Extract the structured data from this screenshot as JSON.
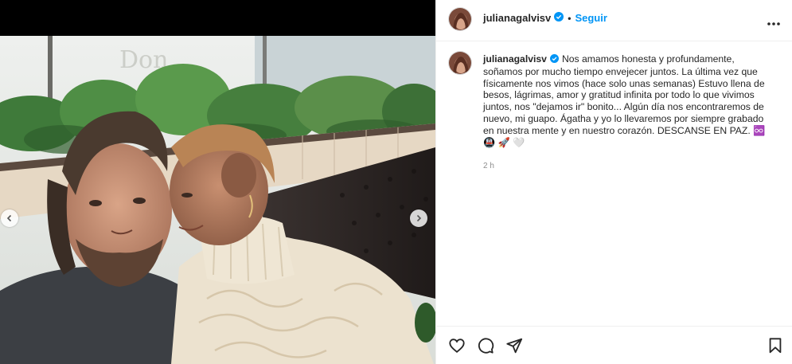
{
  "header": {
    "username": "julianagalvisv",
    "separator": "•",
    "follow_label": "Seguir",
    "verified_icon": "verified-badge-icon",
    "more_icon": "more-horizontal-icon"
  },
  "caption": {
    "username": "julianagalvisv",
    "text": "Nos amamos honesta y profundamente, soñamos por mucho tiempo envejecer juntos. La última vez que físicamente nos vimos (hace solo unas semanas) Estuvo llena de besos, lágrimas, amor y gratitud infinita por todo lo que vivimos juntos, nos \"dejamos ir\" bonito... Algún día nos encontraremos de nuevo, mi guapo. Ágatha y yo lo llevaremos por siempre grabado en nuestra mente y en nuestro corazón. DESCANSE EN PAZ.",
    "emojis": "♾️ 🚇 🚀 🤍",
    "time": "2 h"
  },
  "media": {
    "prev_icon": "chevron-left-icon",
    "next_icon": "chevron-right-icon"
  },
  "actions": {
    "like_icon": "heart-icon",
    "comment_icon": "comment-icon",
    "share_icon": "send-icon",
    "save_icon": "bookmark-icon"
  },
  "colors": {
    "accent": "#0095f6",
    "text": "#262626",
    "muted": "#8e8e8e",
    "border": "#efefef"
  }
}
